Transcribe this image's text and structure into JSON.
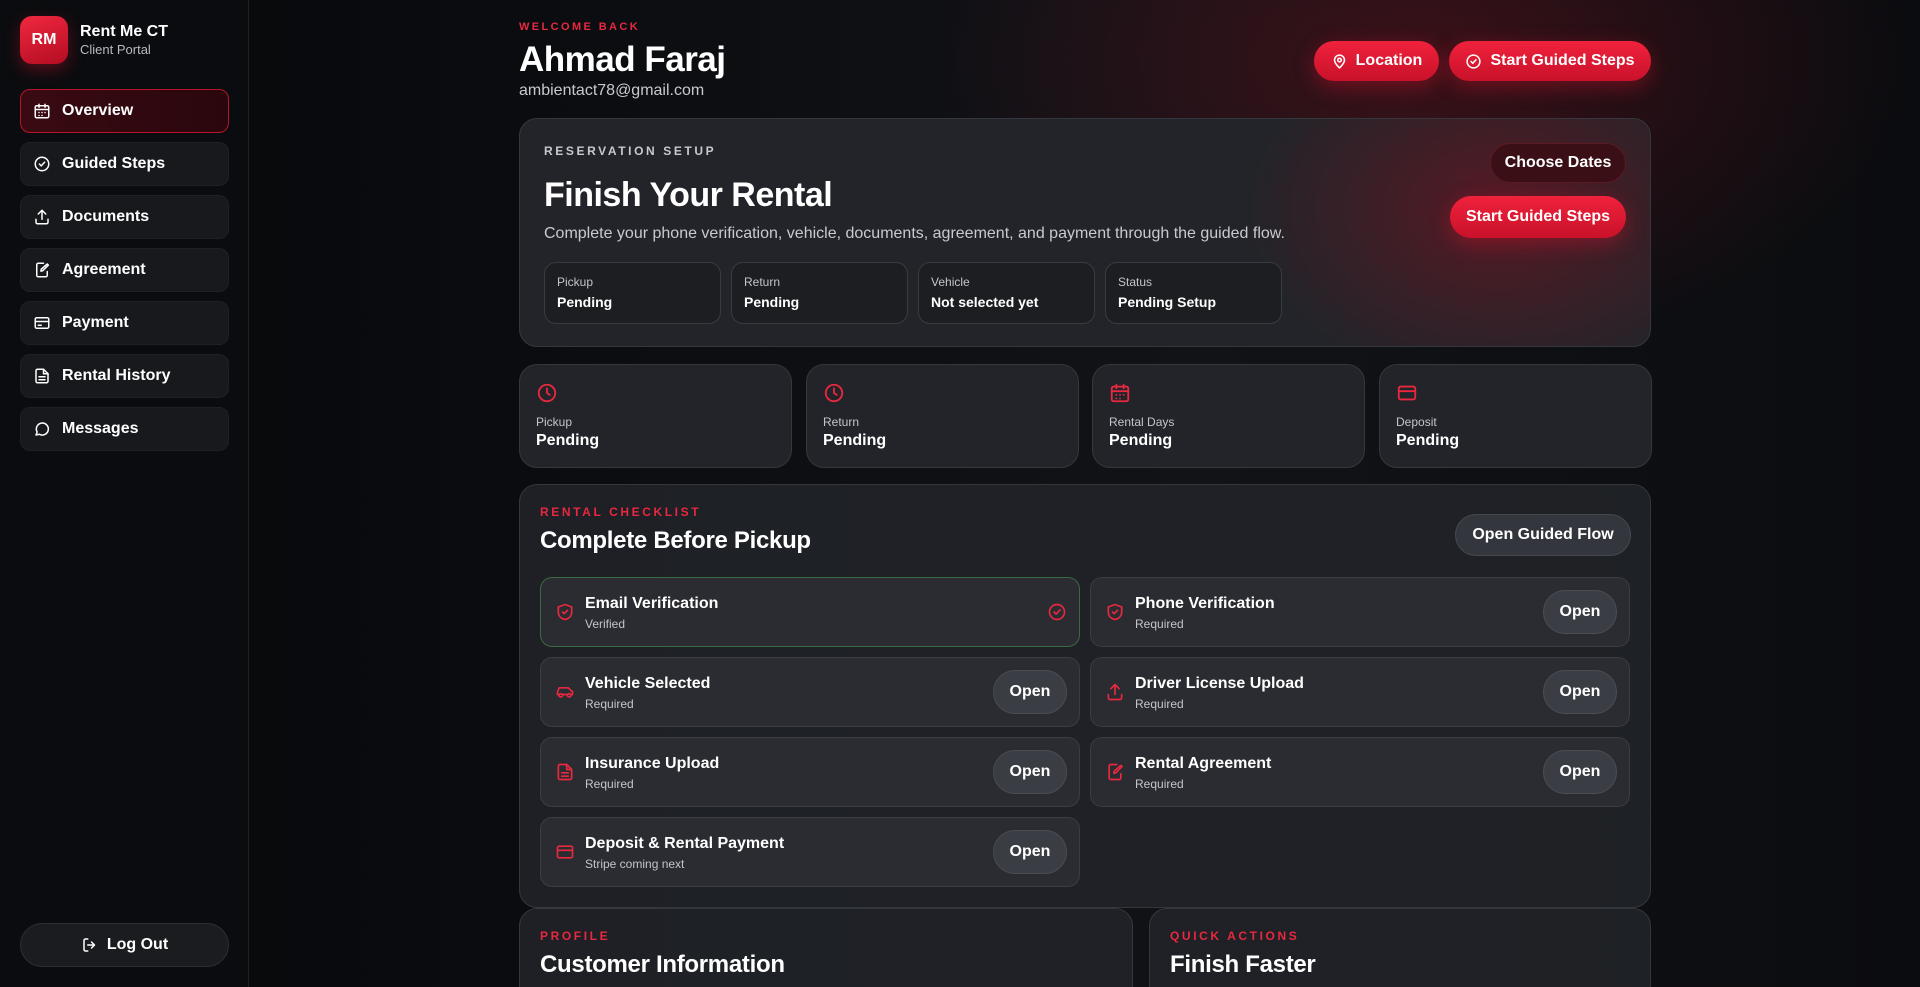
{
  "brand": {
    "logo_text": "RM",
    "name": "Rent Me CT",
    "subtitle": "Client Portal"
  },
  "sidebar": {
    "items": [
      {
        "label": "Overview",
        "icon": "calendar-icon",
        "active": true
      },
      {
        "label": "Guided Steps",
        "icon": "check-circle-icon"
      },
      {
        "label": "Documents",
        "icon": "upload-icon"
      },
      {
        "label": "Agreement",
        "icon": "pen-square-icon"
      },
      {
        "label": "Payment",
        "icon": "credit-card-icon"
      },
      {
        "label": "Rental History",
        "icon": "document-icon"
      },
      {
        "label": "Messages",
        "icon": "chat-bubble-icon"
      }
    ],
    "logout_label": "Log Out"
  },
  "header": {
    "eyebrow": "WELCOME BACK",
    "user_name": "Ahmad Faraj",
    "user_email": "ambientact78@gmail.com",
    "location_label": "Location",
    "guided_label": "Start Guided Steps"
  },
  "reservation": {
    "eyebrow": "RESERVATION SETUP",
    "title": "Finish Your Rental",
    "description": "Complete your phone verification, vehicle, documents, agreement, and payment through the guided flow.",
    "choose_dates_label": "Choose Dates",
    "guided_label": "Start Guided Steps",
    "fields": [
      {
        "label": "Pickup",
        "value": "Pending"
      },
      {
        "label": "Return",
        "value": "Pending"
      },
      {
        "label": "Vehicle",
        "value": "Not selected yet"
      },
      {
        "label": "Status",
        "value": "Pending Setup"
      }
    ]
  },
  "stats": [
    {
      "label": "Pickup",
      "value": "Pending",
      "icon": "clock-icon"
    },
    {
      "label": "Return",
      "value": "Pending",
      "icon": "clock-icon"
    },
    {
      "label": "Rental Days",
      "value": "Pending",
      "icon": "calendar-icon"
    },
    {
      "label": "Deposit",
      "value": "Pending",
      "icon": "credit-card-icon"
    }
  ],
  "checklist": {
    "eyebrow": "RENTAL CHECKLIST",
    "title": "Complete Before Pickup",
    "open_flow_label": "Open Guided Flow",
    "open_label": "Open",
    "tasks": [
      {
        "name": "Email Verification",
        "status": "Verified",
        "icon": "shield-icon",
        "done": true
      },
      {
        "name": "Phone Verification",
        "status": "Required",
        "icon": "shield-icon"
      },
      {
        "name": "Vehicle Selected",
        "status": "Required",
        "icon": "car-icon"
      },
      {
        "name": "Driver License Upload",
        "status": "Required",
        "icon": "upload-icon"
      },
      {
        "name": "Insurance Upload",
        "status": "Required",
        "icon": "document-icon"
      },
      {
        "name": "Rental Agreement",
        "status": "Required",
        "icon": "pen-square-icon"
      },
      {
        "name": "Deposit & Rental Payment",
        "status": "Stripe coming next",
        "icon": "credit-card-icon"
      }
    ]
  },
  "profile": {
    "eyebrow": "PROFILE",
    "title": "Customer Information"
  },
  "quick_actions": {
    "eyebrow": "QUICK ACTIONS",
    "title": "Finish Faster"
  },
  "colors": {
    "accent": "#e8283f",
    "background": "#0b0c0f",
    "card": "#222429"
  }
}
